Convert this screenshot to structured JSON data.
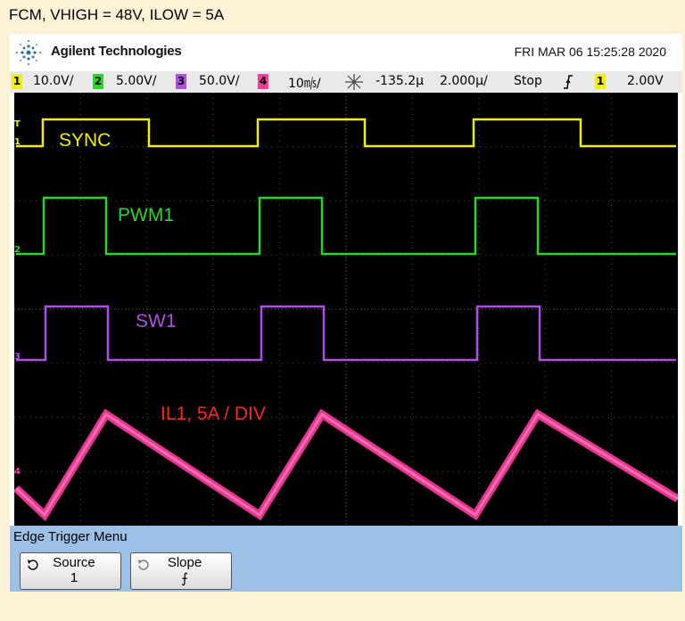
{
  "caption": "FCM, VHIGH = 48V, ILOW = 5A",
  "header": {
    "brand": "Agilent Technologies",
    "datetime": "FRI MAR 06 15:25:28 2020",
    "logo_icon": "agilent-spark-icon"
  },
  "status_bar": {
    "ch1_num": "1",
    "ch1_scale": "10.0V/",
    "ch2_num": "2",
    "ch2_scale": "5.00V/",
    "ch3_num": "3",
    "ch3_scale": "50.0V/",
    "ch4_num": "4",
    "ch4_scale": "10㎧/",
    "delay": "-135.2µ",
    "timebase": "2.000µ/",
    "run_state": "Stop",
    "trigger_slope_icon": "rising-edge-icon",
    "trig_src": "1",
    "trig_level": "2.00V",
    "colors": {
      "ch1": "#f0f000",
      "ch2": "#2ad62a",
      "ch3": "#b04ee6",
      "ch4": "#ff3b9c"
    }
  },
  "traces": {
    "sync": "SYNC",
    "pwm1": "PWM1",
    "sw1": "SW1",
    "il1": "IL1, 5A / DIV"
  },
  "markers": {
    "trigger": "T",
    "ch1": "1",
    "ch2": "2",
    "ch3": "3",
    "ch4": "4"
  },
  "menu": {
    "title": "Edge Trigger Menu",
    "softkeys": [
      {
        "label": "Source",
        "value": "1"
      },
      {
        "label": "Slope",
        "value": "⨍"
      }
    ]
  }
}
